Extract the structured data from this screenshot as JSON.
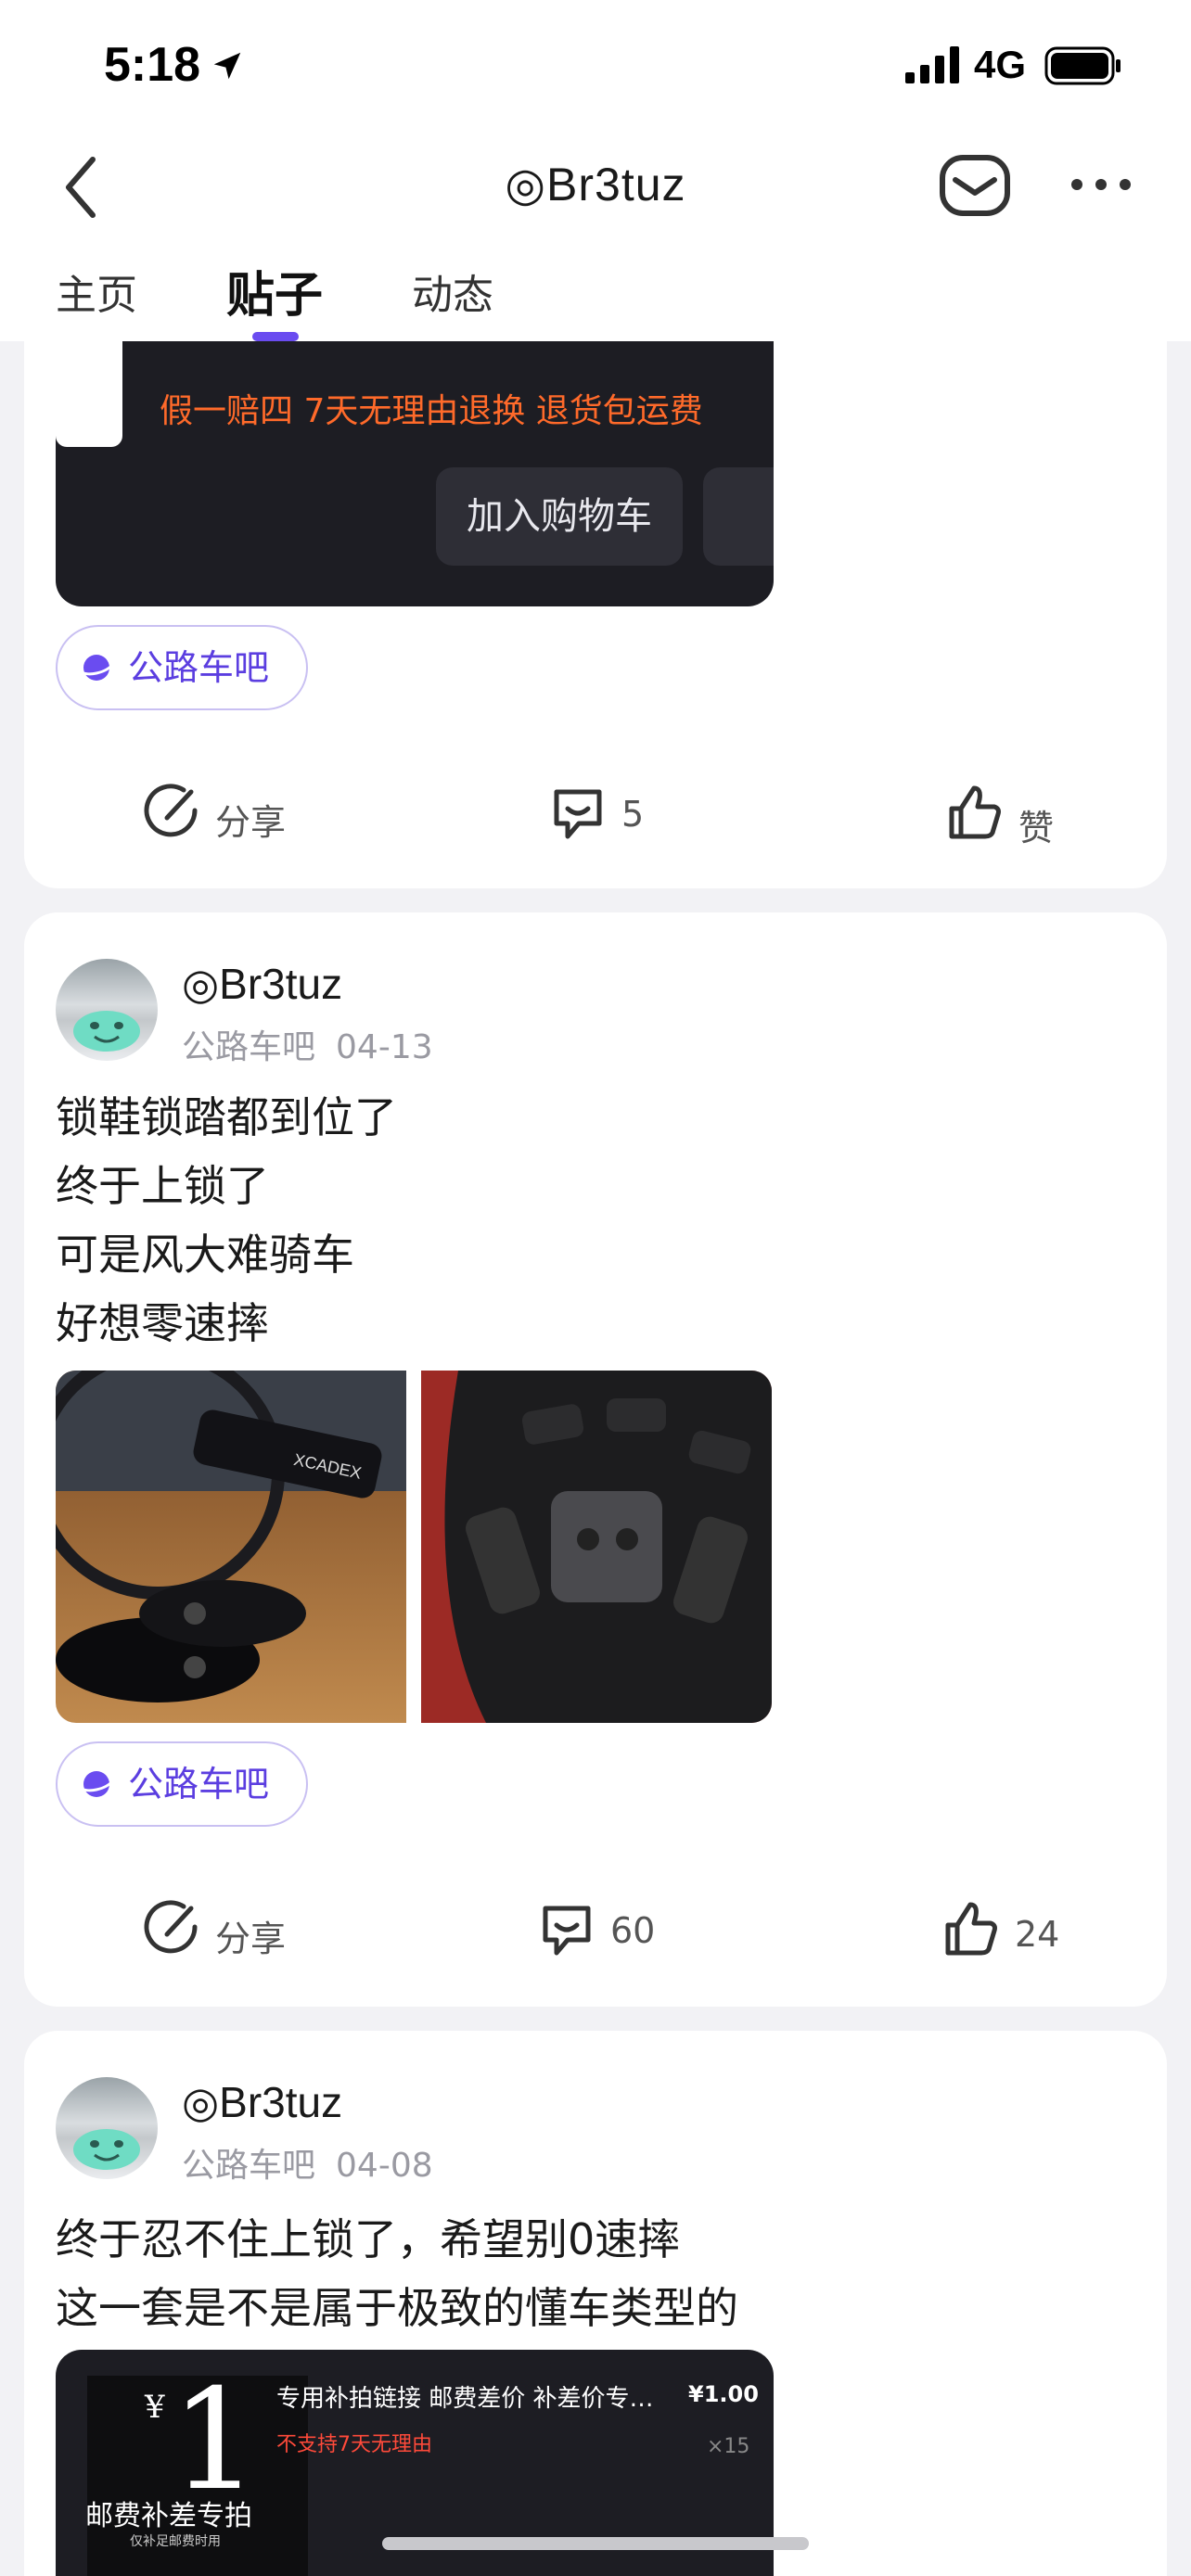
{
  "status_bar": {
    "time": "5:18",
    "network": "4G"
  },
  "nav": {
    "title": "◎Br3tuz"
  },
  "tabs": [
    {
      "label": "主页",
      "active": false
    },
    {
      "label": "贴子",
      "active": true
    },
    {
      "label": "动态",
      "active": false
    }
  ],
  "accent_color": "#6a4cf0",
  "posts": [
    {
      "product": {
        "faded_text": "…",
        "promo": "假一赔四  7天无理由退换  退货包运费",
        "cart_button": "加入购物车"
      },
      "forum_tag": "公路车吧",
      "actions": {
        "share": "分享",
        "comments": "5",
        "likes": "赞"
      }
    },
    {
      "author": "◎Br3tuz",
      "forum": "公路车吧",
      "date": "04-13",
      "lines": [
        "锁鞋锁踏都到位了",
        "终于上锁了",
        "可是风大难骑车",
        "好想零速摔"
      ],
      "photo_brand": "XCADEX",
      "forum_tag": "公路车吧",
      "actions": {
        "share": "分享",
        "comments": "60",
        "likes": "24"
      }
    },
    {
      "author": "◎Br3tuz",
      "forum": "公路车吧",
      "date": "04-08",
      "lines": [
        "终于忍不住上锁了，希望别0速摔",
        "这一套是不是属于极致的懂车类型的"
      ],
      "product": {
        "thumb_yen": "¥",
        "thumb_number": "1",
        "thumb_caption": "邮费补差专拍",
        "thumb_subcaption": "仅补足邮费时用",
        "title": "专用补拍链接 邮费差价 补差价专…",
        "note": "不支持7天无理由",
        "price": "¥1.00",
        "qty": "×15"
      }
    }
  ]
}
